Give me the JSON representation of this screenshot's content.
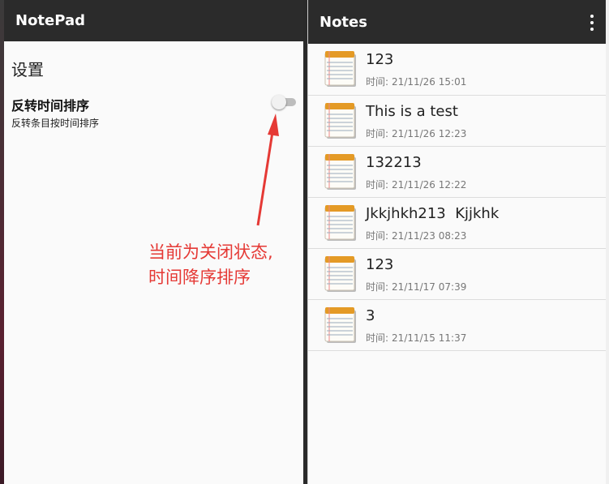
{
  "left_app": {
    "title": "NotePad",
    "settings_heading": "设置",
    "preference": {
      "title": "反转时间排序",
      "summary": "反转条目按时间排序",
      "enabled": false
    },
    "annotation": "当前为关闭状态,\n时间降序排序",
    "annotation_color": "#e53935"
  },
  "right_app": {
    "title": "Notes",
    "overflow_icon": "more-vert-icon",
    "time_label": "时间:",
    "notes": [
      {
        "title": "123",
        "time": "21/11/26 15:01"
      },
      {
        "title": "This is a test",
        "time": "21/11/26 12:23"
      },
      {
        "title": "132213",
        "time": "21/11/26 12:22"
      },
      {
        "title": "Jkkjhkh213  Kjjkhk",
        "time": "21/11/23 08:23"
      },
      {
        "title": "123",
        "time": "21/11/17 07:39"
      },
      {
        "title": "3",
        "time": "21/11/15 11:37"
      }
    ]
  },
  "colors": {
    "appbar": "#2b2b2b",
    "background": "#fafafa",
    "annotation": "#e53935"
  }
}
